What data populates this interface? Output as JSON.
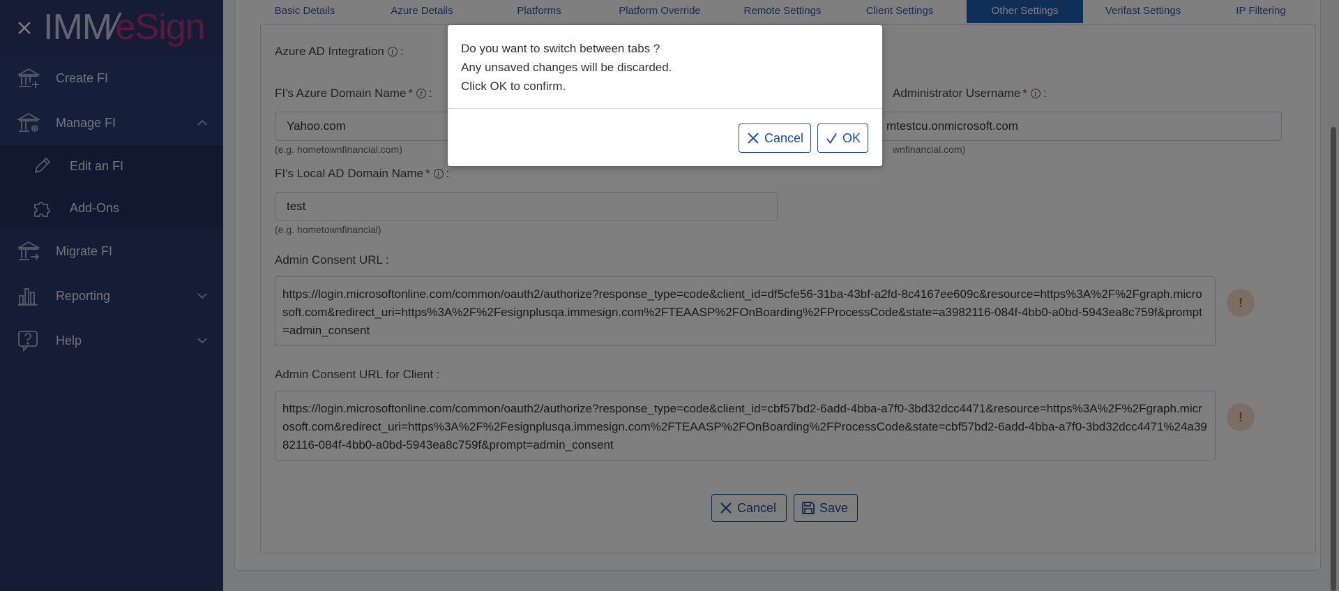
{
  "brand": {
    "logo_imm": "IMM",
    "logo_slash": "/",
    "logo_esign": "eSign"
  },
  "sidebar": {
    "items": [
      {
        "label": "Create FI"
      },
      {
        "label": "Manage FI"
      },
      {
        "label": "Edit an FI"
      },
      {
        "label": "Add-Ons"
      },
      {
        "label": "Migrate FI"
      },
      {
        "label": "Reporting"
      },
      {
        "label": "Help"
      }
    ]
  },
  "tabs": [
    {
      "label": "Basic Details"
    },
    {
      "label": "Azure Details"
    },
    {
      "label": "Platforms"
    },
    {
      "label": "Platform Override"
    },
    {
      "label": "Remote Settings"
    },
    {
      "label": "Client Settings"
    },
    {
      "label": "Other Settings",
      "active": true
    },
    {
      "label": "Verifast Settings"
    },
    {
      "label": "IP Filtering"
    }
  ],
  "form": {
    "azure_ad_label": "Azure AD Integration",
    "domain_label": "FI's Azure Domain Name",
    "domain_value": "Yahoo.com",
    "domain_hint": "(e.g. hometownfinancial.com)",
    "admin_user_label": "Administrator Username",
    "admin_user_value": "mtestcu.onmicrosoft.com",
    "admin_user_hint": "wnfinancial.com)",
    "local_ad_label": "FI's Local AD Domain Name",
    "local_ad_value": "test",
    "local_ad_hint": "(e.g. hometownfinancial)",
    "consent_url_label": "Admin Consent URL :",
    "consent_url_value": "https://login.microsoftonline.com/common/oauth2/authorize?response_type=code&client_id=df5cfe56-31ba-43bf-a2fd-8c4167ee609c&resource=https%3A%2F%2Fgraph.microsoft.com&redirect_uri=https%3A%2F%2Fesignplusqa.immesign.com%2FTEAASP%2FOnBoarding%2FProcessCode&state=a3982116-084f-4bb0-a0bd-5943ea8c759f&prompt=admin_consent",
    "consent_client_label": "Admin Consent URL for Client :",
    "consent_client_value": "https://login.microsoftonline.com/common/oauth2/authorize?response_type=code&client_id=cbf57bd2-6add-4bba-a7f0-3bd32dcc4471&resource=https%3A%2F%2Fgraph.microsoft.com&redirect_uri=https%3A%2F%2Fesignplusqa.immesign.com%2FTEAASP%2FOnBoarding%2FProcessCode&state=cbf57bd2-6add-4bba-a7f0-3bd32dcc4471%24a3982116-084f-4bb0-a0bd-5943ea8c759f&prompt=admin_consent",
    "warn_glyph": "!",
    "cancel_label": "Cancel",
    "save_label": "Save"
  },
  "modal": {
    "line1": "Do you want to switch between tabs ?",
    "line2": "Any unsaved changes will be discarded.",
    "line3": "Click OK to confirm.",
    "cancel_label": "Cancel",
    "ok_label": "OK"
  },
  "colors": {
    "sidebar_bg": "#283a6b",
    "accent": "#1f5fb0",
    "brand_magenta": "#b2327a",
    "required": "#d21f3c"
  }
}
